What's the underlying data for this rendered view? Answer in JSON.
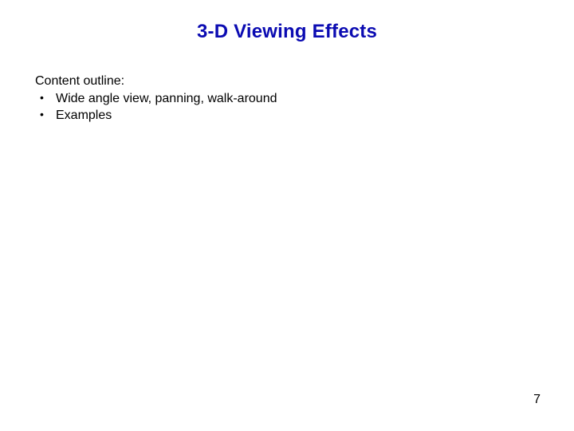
{
  "title": "3-D Viewing Effects",
  "outline_label": "Content outline:",
  "bullets": [
    "Wide angle view, panning, walk-around",
    "Examples"
  ],
  "page_number": "7",
  "colors": {
    "title": "#0b0bb2",
    "text": "#000000",
    "background": "#ffffff"
  }
}
